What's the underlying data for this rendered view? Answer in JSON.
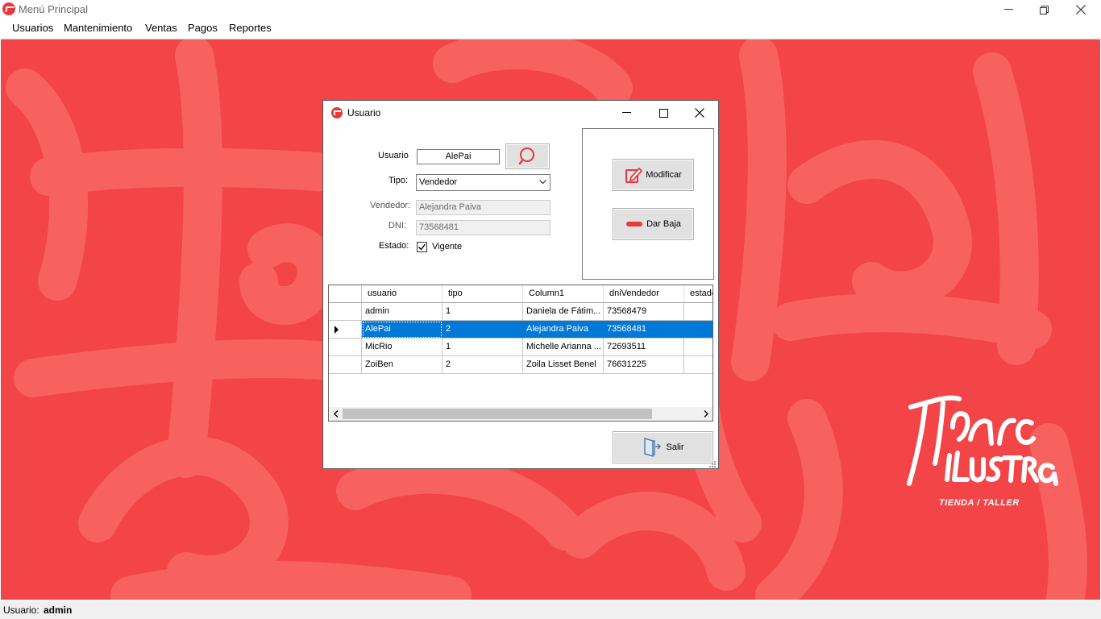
{
  "window": {
    "title": "Menú Principal"
  },
  "menu": {
    "items": [
      "Usuarios",
      "Mantenimiento",
      "Ventas",
      "Pagos",
      "Reportes"
    ]
  },
  "logo": {
    "line1": "MARC",
    "line2": "ILUSTRA",
    "tagline": "TIENDA / TALLER"
  },
  "status": {
    "label": "Usuario:",
    "user": "admin"
  },
  "dialog": {
    "title": "Usuario",
    "usuario_label": "Usuario",
    "usuario_value": "AlePai",
    "tipo_label": "Tipo:",
    "tipo_value": "Vendedor",
    "vendedor_label": "Vendedor:",
    "vendedor_value": "Alejandra Paiva",
    "dni_label": "DNI:",
    "dni_value": "73568481",
    "estado_label": "Estado:",
    "estado_checkbox_label": "Vigente",
    "estado_checked": true,
    "modificar_label": "Modificar",
    "dar_baja_label": "Dar Baja",
    "salir_label": "Salir"
  },
  "grid": {
    "columns": [
      "usuario",
      "tipo",
      "Column1",
      "dniVendedor",
      "estado"
    ],
    "rows": [
      {
        "usuario": "admin",
        "tipo": "1",
        "column1": "Daniela de Fátim...",
        "dni": "73568479",
        "estado": ""
      },
      {
        "usuario": "AlePai",
        "tipo": "2",
        "column1": "Alejandra Paiva",
        "dni": "73568481",
        "estado": ""
      },
      {
        "usuario": "MicRio",
        "tipo": "1",
        "column1": "Michelle Arianna ...",
        "dni": "72693511",
        "estado": ""
      },
      {
        "usuario": "ZoiBen",
        "tipo": "2",
        "column1": "Zoila Lisset Benel",
        "dni": "76631225",
        "estado": ""
      }
    ],
    "selected_row": 1
  },
  "colors": {
    "background": "#f34447",
    "accent": "#0078d7",
    "brand": "#e8383d"
  }
}
